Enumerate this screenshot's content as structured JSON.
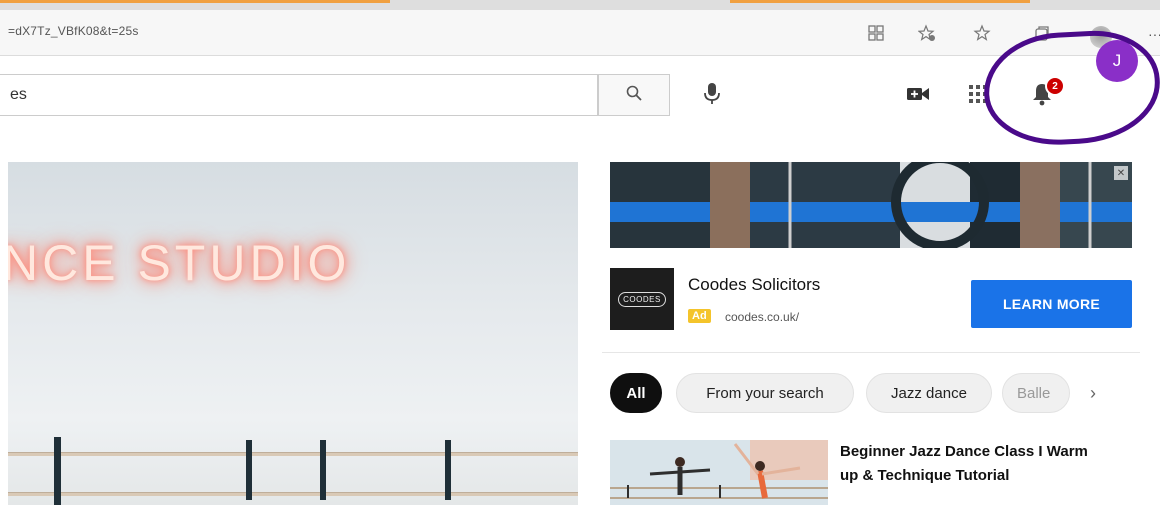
{
  "browser": {
    "url": "=dX7Tz_VBfK08&t=25s",
    "icons": [
      "grid-icon",
      "favorite-add-icon",
      "favorites-icon",
      "collections-icon",
      "profile-icon",
      "more-icon"
    ],
    "menu": "···"
  },
  "header": {
    "search_value": "es",
    "icons": [
      "search-icon",
      "mic-icon",
      "create-video-icon",
      "apps-grid-icon",
      "bell-icon"
    ],
    "notification_count": "2",
    "avatar_letter": "J",
    "annotation_color": "#4a0a8a",
    "avatar_color": "#8a2fc8"
  },
  "player": {
    "neon_text": "NCE STUDIO"
  },
  "ad": {
    "logo_text": "COODES",
    "title": "Coodes Solicitors",
    "badge": "Ad",
    "domain": "coodes.co.uk/",
    "cta": "LEARN MORE",
    "cta_color": "#1a73e8",
    "close": "✕"
  },
  "chips": [
    {
      "label": "All",
      "active": true
    },
    {
      "label": "From your search",
      "active": false
    },
    {
      "label": "Jazz dance",
      "active": false
    },
    {
      "label": "Balle",
      "active": false
    }
  ],
  "chips_next": "›",
  "recommended": [
    {
      "title": "Beginner Jazz Dance Class I Warm up & Technique Tutorial",
      "channel": ""
    }
  ]
}
